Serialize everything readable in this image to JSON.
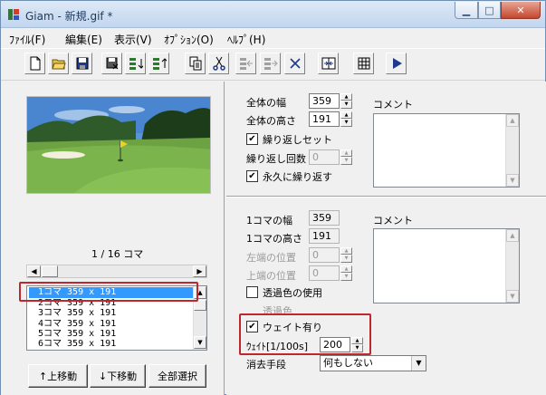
{
  "window": {
    "title": "Giam - 新規.gif *"
  },
  "menu": [
    "ﾌｧｲﾙ(F)",
    "編集(E)",
    "表示(V)",
    "ｵﾌﾟｼｮﾝ(O)",
    "ﾍﾙﾌﾟ(H)"
  ],
  "toolbar_icons": [
    "new-file-icon",
    "open-folder-icon",
    "save-disk-icon",
    "save-as-icon",
    "insert-frame-icon",
    "insert-frame-after-icon",
    "copy-icon",
    "cut-icon",
    "paste-icon",
    "paste-after-icon",
    "delete-icon",
    "optimize-icon",
    "grid-icon",
    "play-icon"
  ],
  "preview": {
    "frame_counter": "1 / 16 コマ"
  },
  "frames": [
    "1コマ 359 x 191",
    "2コマ 359 x 191",
    "3コマ 359 x 191",
    "4コマ 359 x 191",
    "5コマ 359 x 191",
    "6コマ 359 x 191"
  ],
  "left_buttons": {
    "move_up": "↑上移動",
    "move_down": "↓下移動",
    "select_all": "全部選択"
  },
  "global": {
    "width_label": "全体の幅",
    "width_value": "359",
    "height_label": "全体の高さ",
    "height_value": "191",
    "loop_set_label": "繰り返しセット",
    "loop_set_checked": "✔",
    "loop_count_label": "繰り返し回数",
    "loop_count_value": "0",
    "loop_forever_label": "永久に繰り返す",
    "loop_forever_checked": "✔",
    "comment_label": "コメント"
  },
  "frame": {
    "width_label": "1コマの幅",
    "width_value": "359",
    "height_label": "1コマの高さ",
    "height_value": "191",
    "left_label": "左端の位置",
    "left_value": "0",
    "top_label": "上端の位置",
    "top_value": "0",
    "transparent_label": "透過色の使用",
    "transparent_color_label": "透過色",
    "wait_label": "ウェイト有り",
    "wait_checked": "✔",
    "wait_time_label": "ｳｪｲﾄ[1/100s]",
    "wait_time_value": "200",
    "disposal_label": "消去手段",
    "disposal_value": "何もしない",
    "comment_label": "コメント"
  },
  "colors": {
    "selection": "#3399ff",
    "highlight_box": "#c0262d"
  }
}
